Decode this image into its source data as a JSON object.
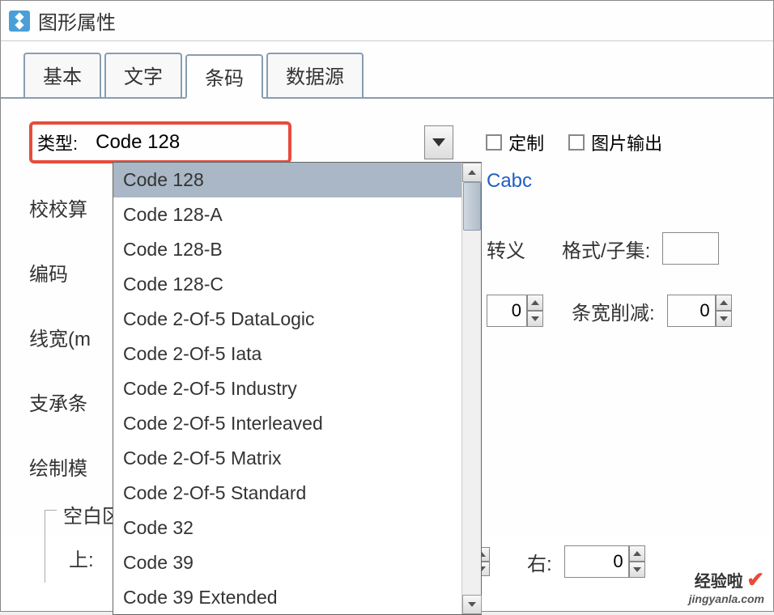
{
  "window": {
    "title": "图形属性"
  },
  "tabs": {
    "basic": "基本",
    "text": "文字",
    "barcode": "条码",
    "datasource": "数据源"
  },
  "labels": {
    "type": "类型:",
    "checksum": "校校算",
    "encoding": "编码",
    "linewidth": "线宽(m",
    "support": "支承条",
    "drawmode": "绘制模",
    "blank": "空白区",
    "top": "上:",
    "custom": "定制",
    "imageout": "图片输出",
    "escape": "转义",
    "formatsub": "格式/子集:",
    "barreduce": "条宽削减:",
    "right": "右:"
  },
  "type_select": {
    "selected": "Code 128",
    "options": [
      "Code 128",
      "Code 128-A",
      "Code 128-B",
      "Code 128-C",
      "Code 2-Of-5 DataLogic",
      "Code 2-Of-5 Iata",
      "Code 2-Of-5 Industry",
      "Code 2-Of-5 Interleaved",
      "Code 2-Of-5 Matrix",
      "Code 2-Of-5 Standard",
      "Code 32",
      "Code 39",
      "Code 39 Extended"
    ]
  },
  "values": {
    "cabc": "Cabc",
    "zero1": "0",
    "zero2": "0",
    "zero3": "0"
  },
  "watermark": {
    "brand": "经验啦",
    "url": "jingyanla.com"
  }
}
